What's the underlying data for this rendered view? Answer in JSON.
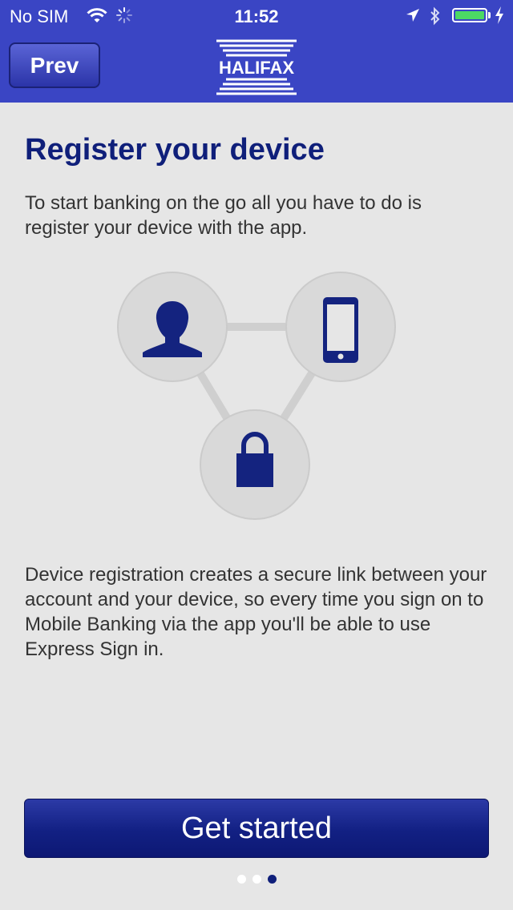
{
  "status_bar": {
    "carrier": "No SIM",
    "time": "11:52",
    "wifi_icon": "wifi-icon",
    "battery_level": 1.0,
    "battery_color": "#4cd964"
  },
  "nav": {
    "prev_label": "Prev",
    "logo_text": "HALIFAX",
    "bar_color": "#3a45c4"
  },
  "content": {
    "title": "Register your device",
    "intro": "To start banking on the go all you have to do is register your device with the app.",
    "diagram_icons": [
      "user-icon",
      "phone-icon",
      "padlock-icon"
    ],
    "description": "Device registration creates a secure link between your account and your device, so every time you sign on to Mobile Banking via the app you'll be able to use Express Sign in."
  },
  "footer": {
    "cta_label": "Get started",
    "pages": 3,
    "active_page": 3,
    "accent": "#0f1f7a"
  }
}
